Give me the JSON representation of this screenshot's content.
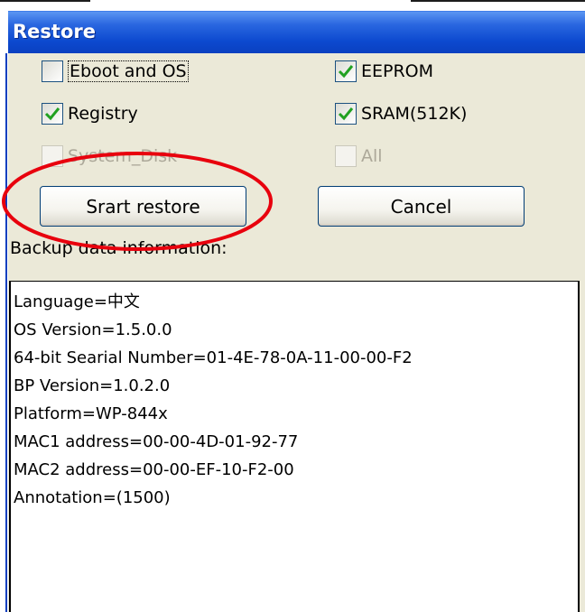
{
  "window": {
    "title": "Restore"
  },
  "options": {
    "eboot_os": {
      "label": "Eboot and OS",
      "checked": false,
      "enabled": true
    },
    "eeprom": {
      "label": "EEPROM",
      "checked": true,
      "enabled": true
    },
    "registry": {
      "label": "Registry",
      "checked": true,
      "enabled": true
    },
    "sram": {
      "label": "SRAM(512K)",
      "checked": true,
      "enabled": true
    },
    "system_disk": {
      "label": "System_Disk",
      "checked": false,
      "enabled": false
    },
    "all": {
      "label": "All",
      "checked": false,
      "enabled": false
    }
  },
  "buttons": {
    "start_restore": "Srart restore",
    "cancel": "Cancel"
  },
  "info": {
    "label": "Backup data information:",
    "lines": [
      "Language=中文",
      "OS Version=1.5.0.0",
      "64-bit Searial Number=01-4E-78-0A-11-00-00-F2",
      "BP Version=1.0.2.0",
      "Platform=WP-844x",
      "MAC1 address=00-00-4D-01-92-77",
      "MAC2 address=00-00-EF-10-F2-00",
      "Annotation=(1500)"
    ]
  },
  "colors": {
    "titlebar": "#0c49cf",
    "dialog_bg": "#ebe9d8",
    "check_green": "#21a121",
    "annotation_oval": "#e8000d"
  }
}
